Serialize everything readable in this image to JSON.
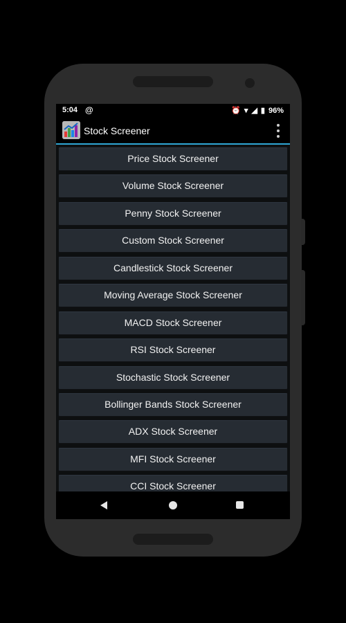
{
  "statusbar": {
    "time": "5:04",
    "left_icon": "at-icon",
    "battery": "96%",
    "icons": [
      "alarm-icon",
      "wifi-icon",
      "signal-icon",
      "battery-icon"
    ]
  },
  "appbar": {
    "title": "Stock Screener",
    "accent": "#2fa7d6"
  },
  "menu": {
    "items": [
      "Price Stock Screener",
      "Volume Stock Screener",
      "Penny Stock Screener",
      "Custom Stock Screener",
      "Candlestick Stock Screener",
      "Moving Average Stock Screener",
      "MACD Stock Screener",
      "RSI Stock Screener",
      "Stochastic Stock Screener",
      "Bollinger Bands Stock Screener",
      "ADX Stock Screener",
      "MFI Stock Screener",
      "CCI Stock Screener"
    ]
  },
  "navbar": {
    "icons": [
      "back-icon",
      "home-icon",
      "recents-icon"
    ]
  }
}
